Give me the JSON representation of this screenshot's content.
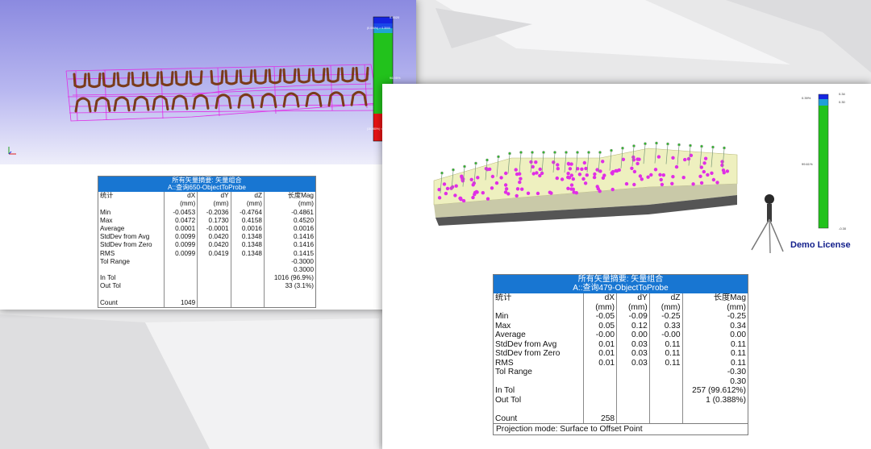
{
  "left_window": {
    "scale_labels": {
      "top": "0.4520",
      "upper_pct": "(0.000%) > 0.3000",
      "mid_pct": "96.95%",
      "lower_pct": "(15.080%) < -0.3000",
      "bottom": "-0.4861"
    },
    "report": {
      "title": "所有矢量摘要: 矢量组合",
      "subtitle": "A::查询650-ObjectToProbe",
      "header_label": "统计",
      "columns": [
        {
          "name": "dX",
          "unit": "(mm)"
        },
        {
          "name": "dY",
          "unit": "(mm)"
        },
        {
          "name": "dZ",
          "unit": "(mm)"
        },
        {
          "name": "长度Mag",
          "unit": "(mm)"
        }
      ],
      "rows": [
        {
          "label": "Min",
          "values": [
            "-0.0453",
            "-0.2036",
            "-0.4764",
            "-0.4861"
          ]
        },
        {
          "label": "Max",
          "values": [
            "0.0472",
            "0.1730",
            "0.4158",
            "0.4520"
          ]
        },
        {
          "label": "Average",
          "values": [
            "0.0001",
            "-0.0001",
            "0.0016",
            "0.0016"
          ]
        },
        {
          "label": "StdDev from Avg",
          "values": [
            "0.0099",
            "0.0420",
            "0.1348",
            "0.1416"
          ]
        },
        {
          "label": "StdDev from Zero",
          "values": [
            "0.0099",
            "0.0420",
            "0.1348",
            "0.1416"
          ]
        },
        {
          "label": "RMS",
          "values": [
            "0.0099",
            "0.0419",
            "0.1348",
            "0.1415"
          ]
        },
        {
          "label": "Tol Range",
          "values": [
            "",
            "",
            "",
            "-0.3000"
          ]
        },
        {
          "label": "",
          "values": [
            "",
            "",
            "",
            "0.3000"
          ]
        },
        {
          "label": "In Tol",
          "values": [
            "",
            "",
            "",
            "1016 (96.9%)"
          ]
        },
        {
          "label": "Out Tol",
          "values": [
            "",
            "",
            "",
            "33 (3.1%)"
          ]
        },
        {
          "label": "",
          "values": [
            "",
            "",
            "",
            ""
          ]
        },
        {
          "label": "Count",
          "values": [
            "1049",
            "",
            "",
            ""
          ]
        }
      ]
    }
  },
  "right_window": {
    "scale_labels": {
      "top": "0.34",
      "top2": "0.30",
      "upper_pct": "0.39%",
      "mid_pct": "99.61%",
      "bottom": "-0.30"
    },
    "watermark": "Demo License",
    "report": {
      "title": "所有矢量摘要: 矢量组合",
      "subtitle": "A::查询479-ObjectToProbe",
      "header_label": "统计",
      "columns": [
        {
          "name": "dX",
          "unit": "(mm)"
        },
        {
          "name": "dY",
          "unit": "(mm)"
        },
        {
          "name": "dZ",
          "unit": "(mm)"
        },
        {
          "name": "长度Mag",
          "unit": "(mm)"
        }
      ],
      "rows": [
        {
          "label": "Min",
          "values": [
            "-0.05",
            "-0.09",
            "-0.25",
            "-0.25"
          ]
        },
        {
          "label": "Max",
          "values": [
            "0.05",
            "0.12",
            "0.33",
            "0.34"
          ]
        },
        {
          "label": "Average",
          "values": [
            "-0.00",
            "0.00",
            "-0.00",
            "0.00"
          ]
        },
        {
          "label": "StdDev from Avg",
          "values": [
            "0.01",
            "0.03",
            "0.11",
            "0.11"
          ]
        },
        {
          "label": "StdDev from Zero",
          "values": [
            "0.01",
            "0.03",
            "0.11",
            "0.11"
          ]
        },
        {
          "label": "RMS",
          "values": [
            "0.01",
            "0.03",
            "0.11",
            "0.11"
          ]
        },
        {
          "label": "Tol Range",
          "values": [
            "",
            "",
            "",
            "-0.30"
          ]
        },
        {
          "label": "",
          "values": [
            "",
            "",
            "",
            "0.30"
          ]
        },
        {
          "label": "In Tol",
          "values": [
            "",
            "",
            "",
            "257 (99.612%)"
          ]
        },
        {
          "label": "Out Tol",
          "values": [
            "",
            "",
            "",
            "1 (0.388%)"
          ]
        },
        {
          "label": "",
          "values": [
            "",
            "",
            "",
            ""
          ]
        },
        {
          "label": "Count",
          "values": [
            "258",
            "",
            "",
            ""
          ]
        }
      ],
      "footer": "Projection mode: Surface to Offset Point"
    }
  },
  "colors": {
    "report_header": "#1876d2",
    "scale_blue": "#1525e0",
    "scale_green": "#22c21c",
    "scale_red": "#e81414",
    "profile_magenta": "#e02ee6",
    "section_brown": "#7a3b1a"
  }
}
